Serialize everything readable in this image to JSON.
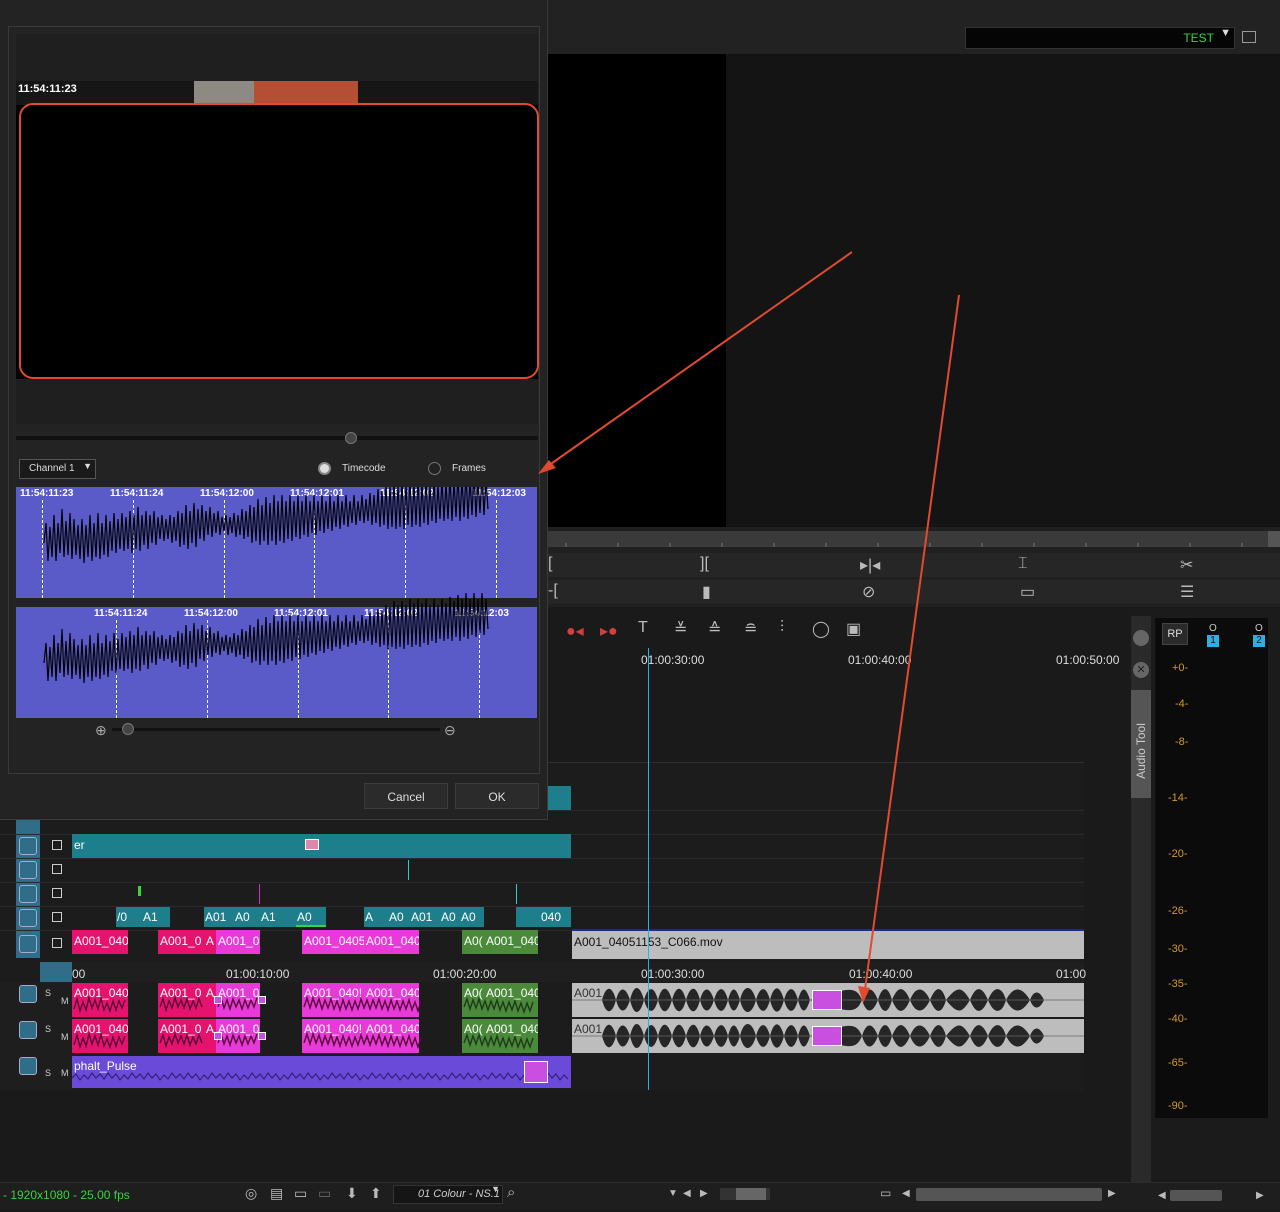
{
  "viewer": {
    "test_label": "TEST"
  },
  "timeline": {
    "ruler_top": [
      "01:00:30:00",
      "01:00:40:00",
      "01:00:50:00"
    ],
    "ruler_main": [
      "00",
      "01:00:10:00",
      "01:00:20:00",
      "01:00:30:00",
      "01:00:40:00",
      "01:00"
    ],
    "track_s": "S",
    "track_m": "M",
    "clips": {
      "v_er": "er",
      "v1_a": "A001_0405",
      "v1_b": "A001_0",
      "v1_c": "A",
      "v1_d": "A001_0",
      "v1_e": "A001_0405",
      "v1_f": "A001_040",
      "v1_g": "A0(",
      "v1_h": "A001_040",
      "v1_mov": "A001_04051153_C066.mov",
      "fx_1": "/0",
      "fx_2": "A1",
      "fx_3": "A01",
      "fx_4": "A0",
      "fx_5": "A1",
      "fx_6": "A0",
      "fx_7": "A",
      "fx_8": "A0",
      "fx_9": "A01",
      "fx_10": "A0",
      "fx_11": "A0",
      "fx_12": "040",
      "a1_a": "A001_0405",
      "a1_b": "A001_0",
      "a1_c": "A",
      "a1_d": "A001_0",
      "a1_e": "A001_040!",
      "a1_f": "A001_040",
      "a1_g": "A0(",
      "a1_h": "A001_040",
      "a1_mov": "A001",
      "a3_name": "phalt_Pulse"
    }
  },
  "audio_tool": {
    "label": "Audio Tool",
    "rp": "RP",
    "ch1": "1",
    "ch2": "2",
    "o1": "O",
    "o2": "O",
    "scale": [
      "+0-",
      "-4-",
      "-8-",
      "-14-",
      "-20-",
      "-26-",
      "-30-",
      "-35-",
      "-40-",
      "-65-",
      "-90-"
    ]
  },
  "dialog": {
    "thumb_tc": "11:54:11:23",
    "channel": "Channel 1",
    "timecode_label": "Timecode",
    "frames_label": "Frames",
    "wave1_tcs": [
      "11:54:11:23",
      "11:54:11:24",
      "11:54:12:00",
      "11:54:12:01",
      "11:54:12:02",
      "11:54:12:03"
    ],
    "wave2_tcs": [
      "11:54:11:24",
      "11:54:12:00",
      "11:54:12:01",
      "11:54:12:02",
      "11:54:12:03"
    ],
    "cancel": "Cancel",
    "ok": "OK"
  },
  "status": {
    "format": "- 1920x1080 - 25.00 fps",
    "colour": "01 Colour - NS.1"
  },
  "colors": {
    "accent_green": "#37d43a",
    "annotation_red": "#e04b2f",
    "waveform_blue": "#5a5ac8",
    "clip_pink": "#e6136e",
    "clip_magenta": "#e83ad8",
    "clip_teal": "#1d7f8c",
    "clip_green": "#4a8a3a",
    "clip_purple": "#6a4ad8",
    "playhead": "#2bb0e6",
    "meter_amber": "#d39a2a"
  }
}
